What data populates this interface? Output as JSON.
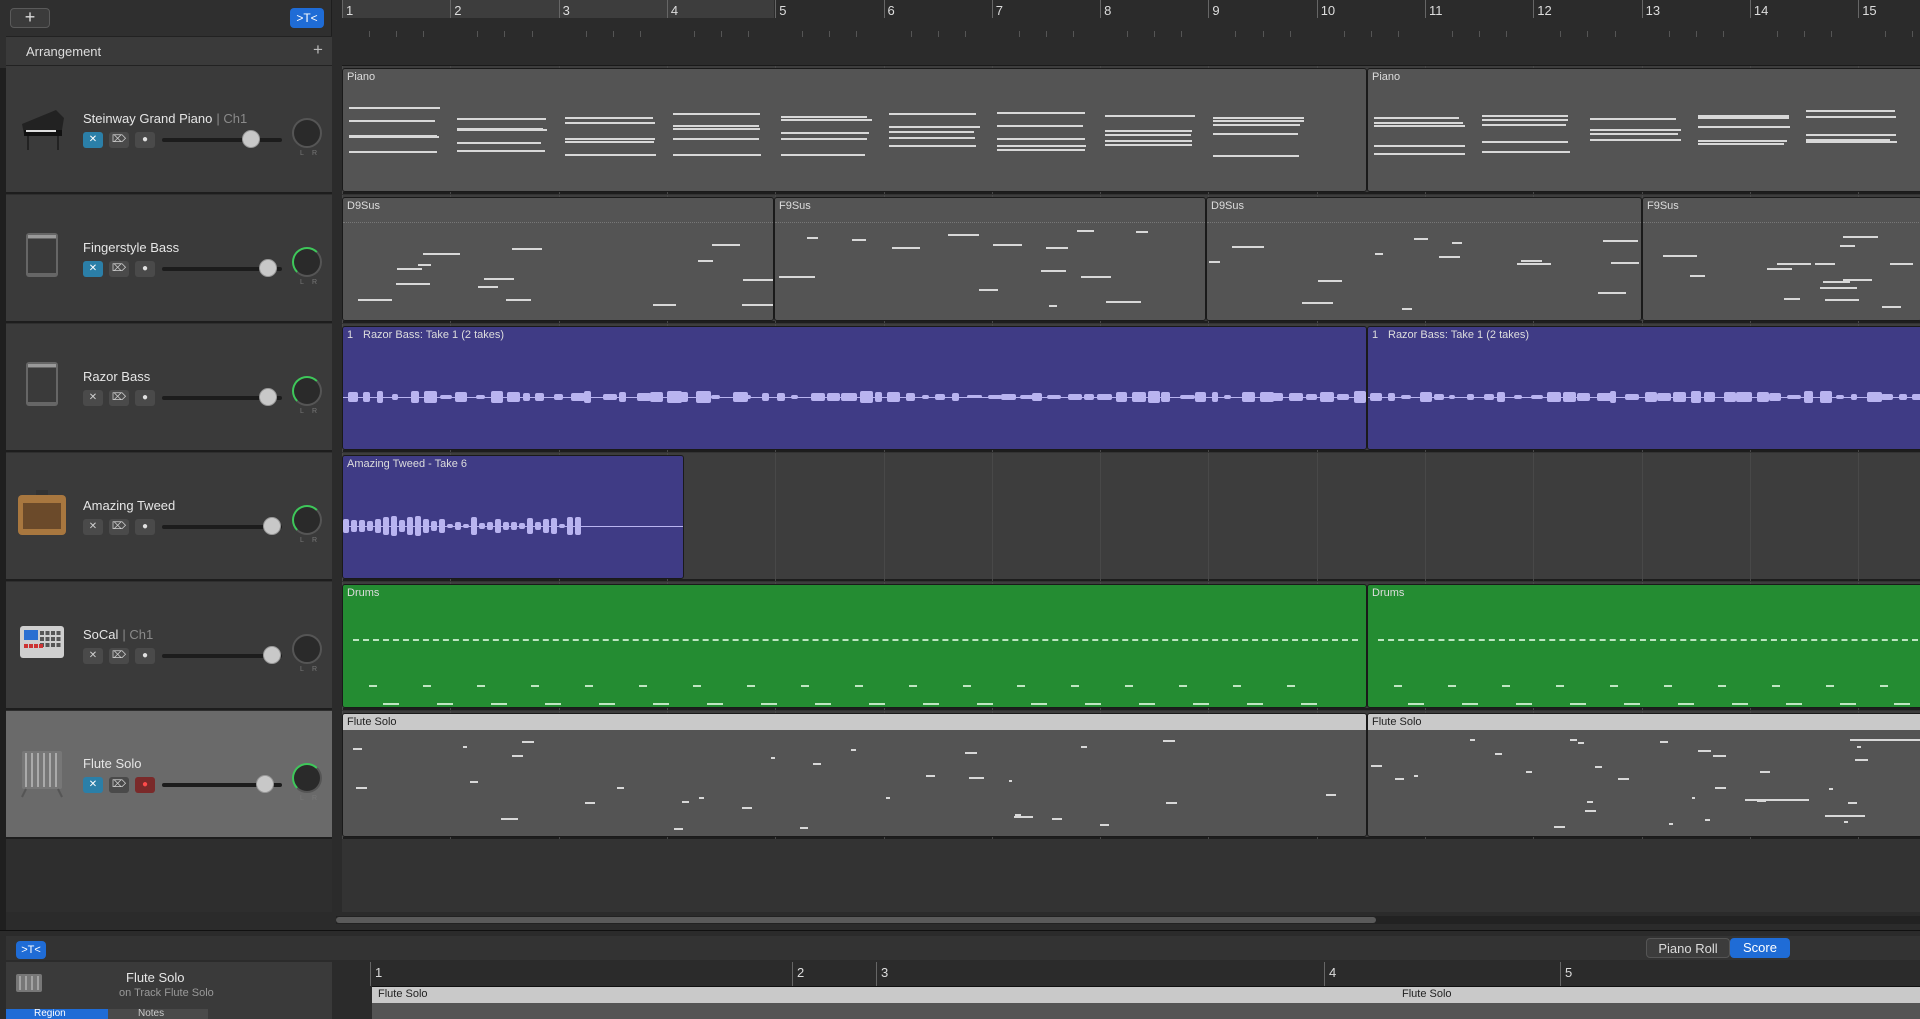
{
  "toolbar": {
    "add_label": "+",
    "catch_label": ">T<"
  },
  "arrangement": {
    "label": "Arrangement",
    "add_label": "+"
  },
  "ruler": {
    "bars": [
      "1",
      "2",
      "3",
      "4",
      "5",
      "6",
      "7",
      "8",
      "9",
      "10",
      "11",
      "12",
      "13",
      "14",
      "15"
    ]
  },
  "tracks": [
    {
      "name": "Steinway Grand Piano",
      "channel": "| Ch1",
      "icon": "grand-piano-icon"
    },
    {
      "name": "Fingerstyle Bass",
      "channel": "",
      "icon": "bass-amp-icon"
    },
    {
      "name": "Razor Bass",
      "channel": "",
      "icon": "bass-amp-icon"
    },
    {
      "name": "Amazing Tweed",
      "channel": "",
      "icon": "guitar-amp-icon"
    },
    {
      "name": "SoCal",
      "channel": "| Ch1",
      "icon": "drum-machine-icon"
    },
    {
      "name": "Flute Solo",
      "channel": "",
      "icon": "flute-instrument-icon"
    }
  ],
  "regions": {
    "piano_a": "Piano",
    "piano_b": "Piano",
    "bass_1": "D9Sus",
    "bass_2": "F9Sus",
    "bass_3": "D9Sus",
    "bass_4": "F9Sus",
    "razor_num_1": "1",
    "razor_1": "Razor Bass: Take 1 (2 takes)",
    "razor_num_2": "1",
    "razor_2": "Razor Bass: Take 1 (2 takes)",
    "tweed": "Amazing Tweed - Take 6",
    "drums_a": "Drums",
    "drums_b": "Drums",
    "flute_a": "Flute Solo",
    "flute_b": "Flute Solo"
  },
  "editor": {
    "catch_label": ">T<",
    "piano_roll_label": "Piano Roll",
    "score_label": "Score",
    "region_title": "Flute Solo",
    "region_sub": "on Track Flute Solo",
    "tab_region": "Region",
    "tab_notes": "Notes",
    "bars": [
      "1",
      "2",
      "3",
      "4",
      "5"
    ],
    "region_label_a": "Flute Solo",
    "region_label_b": "Flute Solo"
  },
  "colors": {
    "accent": "#1f6cd6",
    "audio_region": "#3f3b85",
    "drum_region": "#248c32",
    "midi_region": "#545454"
  }
}
